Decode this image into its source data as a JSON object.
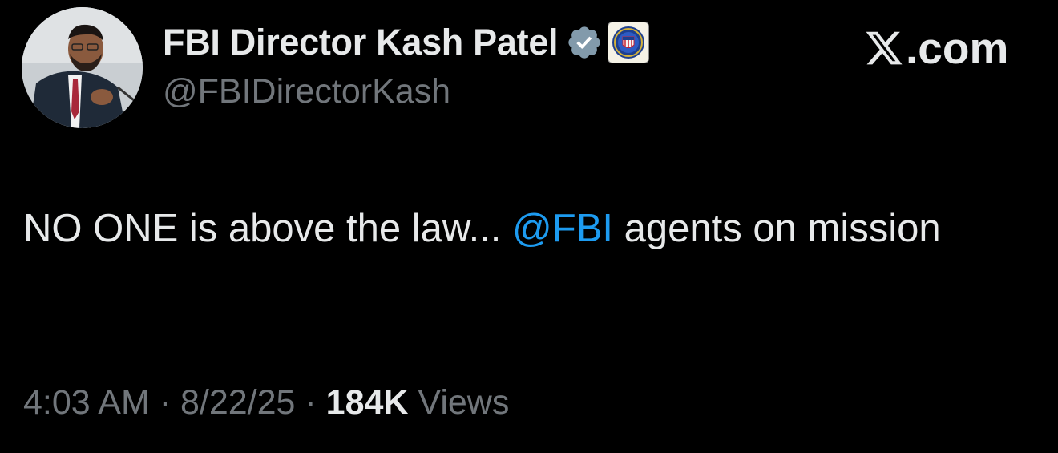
{
  "header": {
    "display_name": "FBI Director Kash Patel",
    "handle": "@FBIDirectorKash",
    "verified_icon": "verified-check-icon",
    "affiliate_icon": "fbi-seal-icon",
    "site_logo": ".com"
  },
  "tweet": {
    "text_before": "NO ONE is above the law... ",
    "mention": "@FBI",
    "text_after": " agents on mission"
  },
  "meta": {
    "time": "4:03 AM",
    "separator1": " · ",
    "date": "8/22/25",
    "separator2": " · ",
    "views_count": "184K",
    "views_label": " Views"
  },
  "colors": {
    "background": "#000000",
    "primary_text": "#e7e9ea",
    "secondary_text": "#71767b",
    "link": "#1d9bf0",
    "verified": "#829aab"
  }
}
